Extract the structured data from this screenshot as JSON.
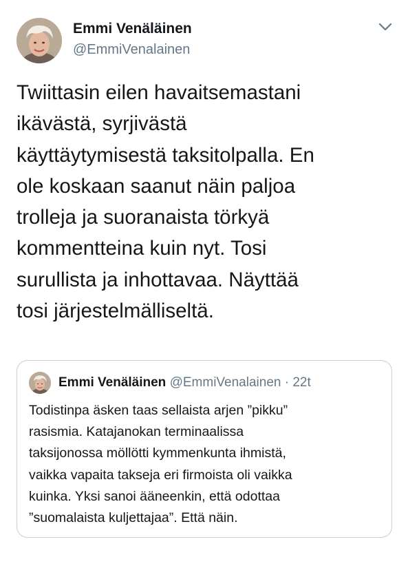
{
  "tweet": {
    "author": {
      "display_name": "Emmi Venäläinen",
      "handle": "@EmmiVenalainen"
    },
    "menu_icon": "chevron-down-icon",
    "text_lines": [
      "Twiittasin eilen havaitsemastani",
      "ikävästä, syrjivästä",
      "käyttäytymisestä taksitolpalla. En",
      "ole koskaan saanut näin paljoa",
      "trolleja ja suoranaista törkyä",
      "kommentteina kuin nyt. Tosi",
      "surullista ja inhottavaa. Näyttää",
      "tosi järjestelmälliseltä."
    ]
  },
  "quoted_tweet": {
    "author": {
      "display_name": "Emmi Venäläinen",
      "handle": "@EmmiVenalainen",
      "separator": " · ",
      "time": "22t"
    },
    "text_lines": [
      "Todistinpa äsken taas sellaista arjen ”pikku”",
      "rasismia. Katajanokan terminaalissa",
      "taksijonossa möllötti kymmenkunta ihmistä,",
      "vaikka vapaita takseja eri firmoista oli vaikka",
      "kuinka. Yksi sanoi ääneenkin, että odottaa",
      "”suomalaista kuljettajaa”. Että näin."
    ]
  },
  "colors": {
    "text_primary": "#14171a",
    "text_secondary": "#657786",
    "border": "#c4cfd6",
    "background": "#ffffff"
  }
}
